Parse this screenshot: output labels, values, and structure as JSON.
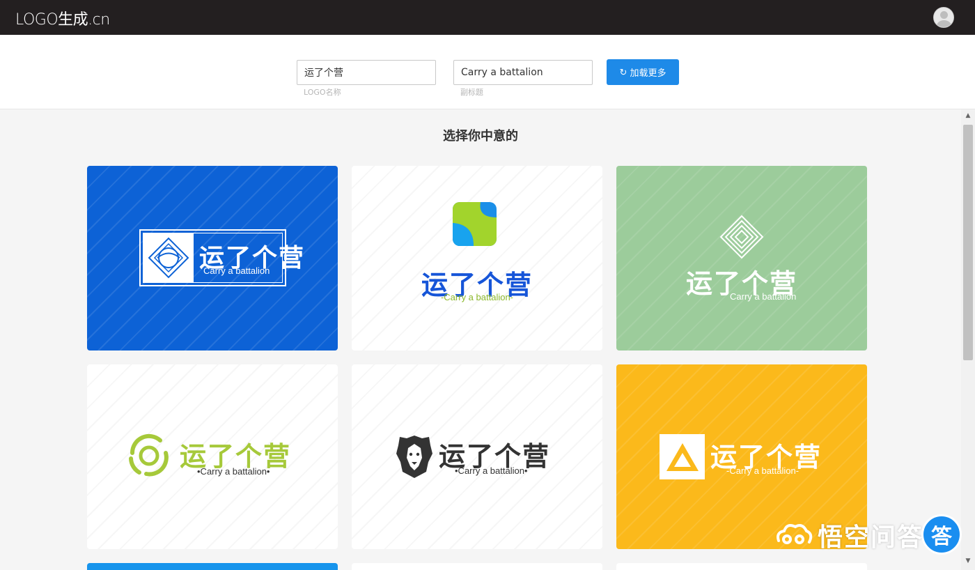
{
  "app": {
    "brand": "LOGO生成.cn"
  },
  "form": {
    "logo_name": {
      "value": "运了个营",
      "hint": "LOGO名称"
    },
    "subtitle": {
      "value": "Carry a battalion",
      "hint": "副标题"
    },
    "load_more_label": "加载更多"
  },
  "main": {
    "title": "选择你中意的",
    "cards": [
      {
        "name": "运了个营",
        "sub": "Carry a battalion",
        "bg": "#0d62d6"
      },
      {
        "name": "运了个营",
        "sub": "-Carry a battalion-",
        "bg": "#ffffff"
      },
      {
        "name": "运了个营",
        "sub": "Carry a battalion",
        "bg": "#9ccc9b"
      },
      {
        "name": "运了个营",
        "sub": "•Carry a battalion•",
        "bg": "#ffffff"
      },
      {
        "name": "运了个营",
        "sub": "•Carry a battalion•",
        "bg": "#ffffff"
      },
      {
        "name": "运了个营",
        "sub": "-Carry a battalion-",
        "bg": "#fbb91b"
      }
    ]
  },
  "watermark": {
    "text": "悟空问答",
    "badge": "答"
  },
  "colors": {
    "accent": "#1e8ae8",
    "topbar": "#231f20"
  }
}
